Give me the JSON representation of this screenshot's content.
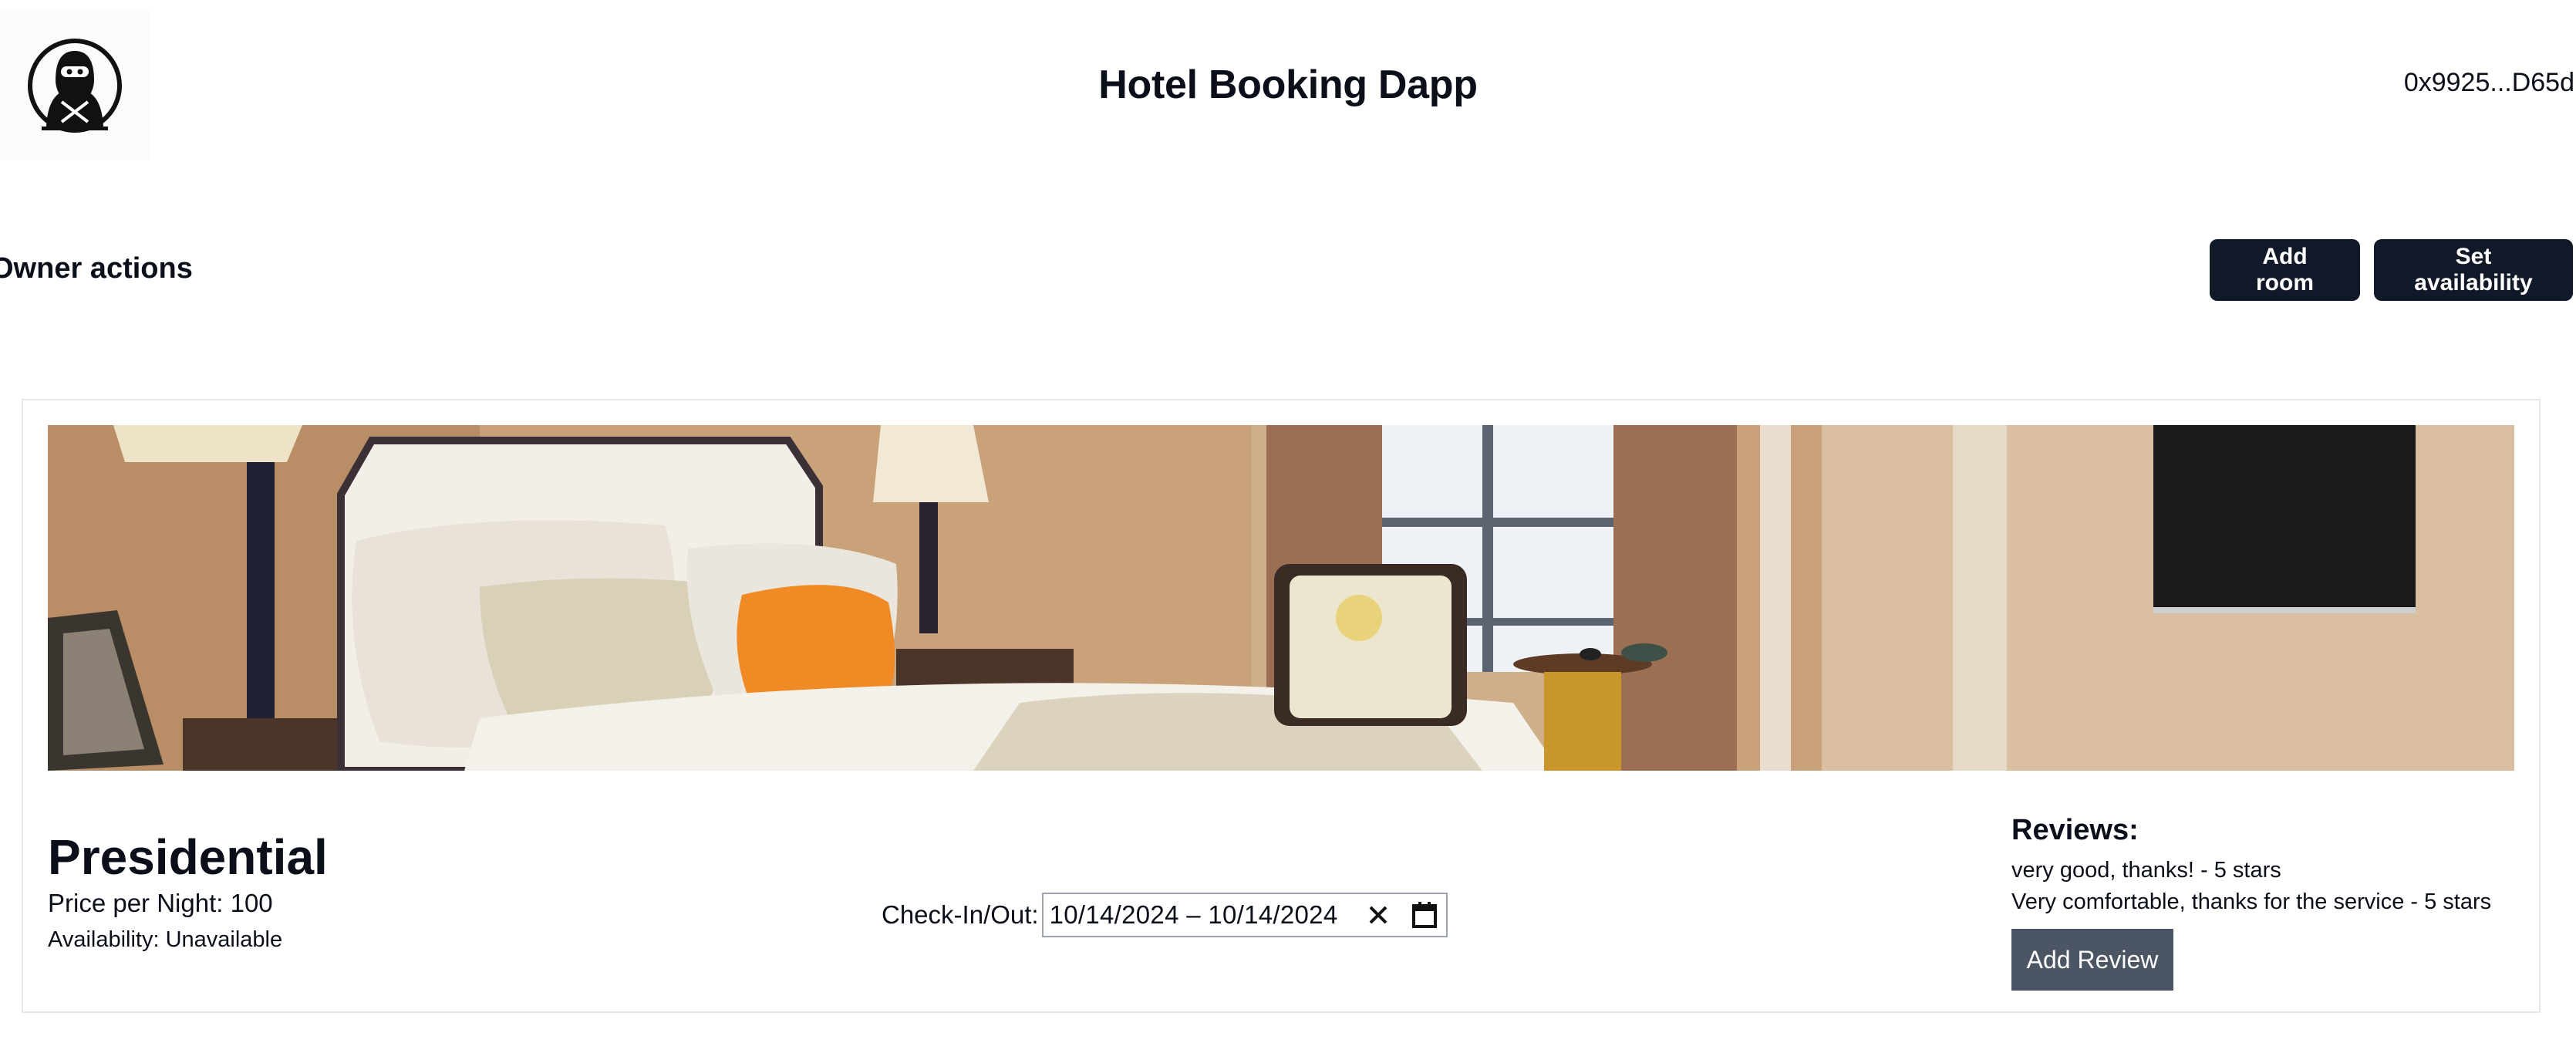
{
  "header": {
    "title": "Hotel Booking Dapp",
    "wallet_address": "0x9925...D65d",
    "logo_icon": "ninja-logo-icon"
  },
  "owner": {
    "title": "Owner actions",
    "add_room_label": "Add room",
    "set_availability_label": "Set availability"
  },
  "room": {
    "name": "Presidential",
    "price_text": "Price per Night: 100",
    "availability_text": "Availability: Unavailable",
    "checkin_label": "Check-In/Out:",
    "date_range": "10/14/2024 – 10/14/2024",
    "clear_icon": "close-icon",
    "calendar_icon": "calendar-icon",
    "reviews_title": "Reviews:",
    "reviews": [
      "very good, thanks! - 5 stars",
      "Very comfortable, thanks for the service - 5 stars"
    ],
    "add_review_label": "Add Review"
  },
  "colors": {
    "primary_button": "#111827",
    "secondary_button": "#4b5563",
    "accent_pillow": "#f08a24"
  }
}
